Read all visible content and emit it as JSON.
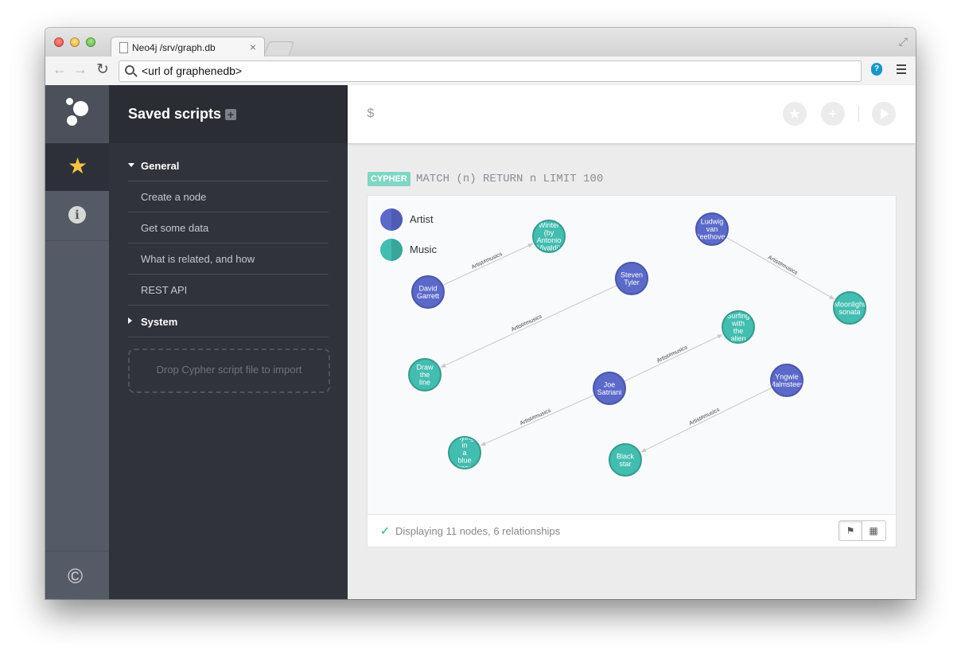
{
  "browser": {
    "tab_title": "Neo4j /srv/graph.db",
    "tab_close": "×",
    "url": "<url of graphenedb>",
    "back_icon": "arrow-left-icon",
    "forward_icon": "arrow-right-icon",
    "reload_icon": "reload-icon",
    "extension_icon": "extension-icon",
    "extension_label": "?",
    "menu_icon": "hamburger-menu-icon"
  },
  "rail": {
    "items": [
      "neo4j-logo",
      "star-icon",
      "info-icon",
      "copyright-icon"
    ],
    "info_glyph": "i",
    "copyright_glyph": "©"
  },
  "drawer": {
    "title": "Saved scripts",
    "add_label": "+",
    "sections": [
      {
        "label": "General",
        "expanded": true,
        "items": [
          "Create a node",
          "Get some data",
          "What is related, and how",
          "REST API"
        ]
      },
      {
        "label": "System",
        "expanded": false,
        "items": []
      }
    ],
    "dropzone": "Drop Cypher script file to import"
  },
  "editor": {
    "prompt": "$",
    "buttons": [
      "star-icon",
      "plus-icon",
      "play-icon"
    ]
  },
  "result": {
    "badge": "CYPHER",
    "query": "MATCH (n) RETURN n LIMIT 100",
    "legend": [
      {
        "label": "Artist",
        "color": "#5b69c9"
      },
      {
        "label": "Music",
        "color": "#42bdb0"
      }
    ],
    "nodes": [
      {
        "id": "david",
        "label": [
          "David",
          "Garrett"
        ],
        "type": "Artist"
      },
      {
        "id": "winter",
        "label": [
          "Winter",
          "(by",
          "Antonio",
          "Vivaldi)"
        ],
        "type": "Music"
      },
      {
        "id": "ludwig",
        "label": [
          "Ludwig",
          "van",
          "Beethoven"
        ],
        "type": "Artist"
      },
      {
        "id": "moonlight",
        "label": [
          "Moonlight",
          "sonata"
        ],
        "type": "Music"
      },
      {
        "id": "steven",
        "label": [
          "Steven",
          "Tyler"
        ],
        "type": "Artist"
      },
      {
        "id": "draw",
        "label": [
          "Draw",
          "the",
          "line"
        ],
        "type": "Music"
      },
      {
        "id": "surfing",
        "label": [
          "Surfing",
          "with",
          "the",
          "alien"
        ],
        "type": "Music"
      },
      {
        "id": "joe",
        "label": [
          "Joe",
          "Satriani"
        ],
        "type": "Artist"
      },
      {
        "id": "yngwie",
        "label": [
          "Yngwie",
          "Malmsteen"
        ],
        "type": "Artist"
      },
      {
        "id": "flying",
        "label": [
          "Flying",
          "in",
          "a",
          "blue",
          "dream"
        ],
        "type": "Music"
      },
      {
        "id": "black",
        "label": [
          "Black",
          "star"
        ],
        "type": "Music"
      }
    ],
    "relationships": [
      {
        "from": "david",
        "to": "winter",
        "label": "Artist#musics"
      },
      {
        "from": "ludwig",
        "to": "moonlight",
        "label": "Artist#musics"
      },
      {
        "from": "steven",
        "to": "draw",
        "label": "Artist#musics"
      },
      {
        "from": "joe",
        "to": "surfing",
        "label": "Artist#musics"
      },
      {
        "from": "joe",
        "to": "flying",
        "label": "Artist#musics"
      },
      {
        "from": "yngwie",
        "to": "black",
        "label": "Artist#musics"
      }
    ],
    "status": "Displaying 11 nodes, 6 relationships",
    "view_buttons": [
      "graph-view-icon",
      "table-view-icon"
    ]
  }
}
